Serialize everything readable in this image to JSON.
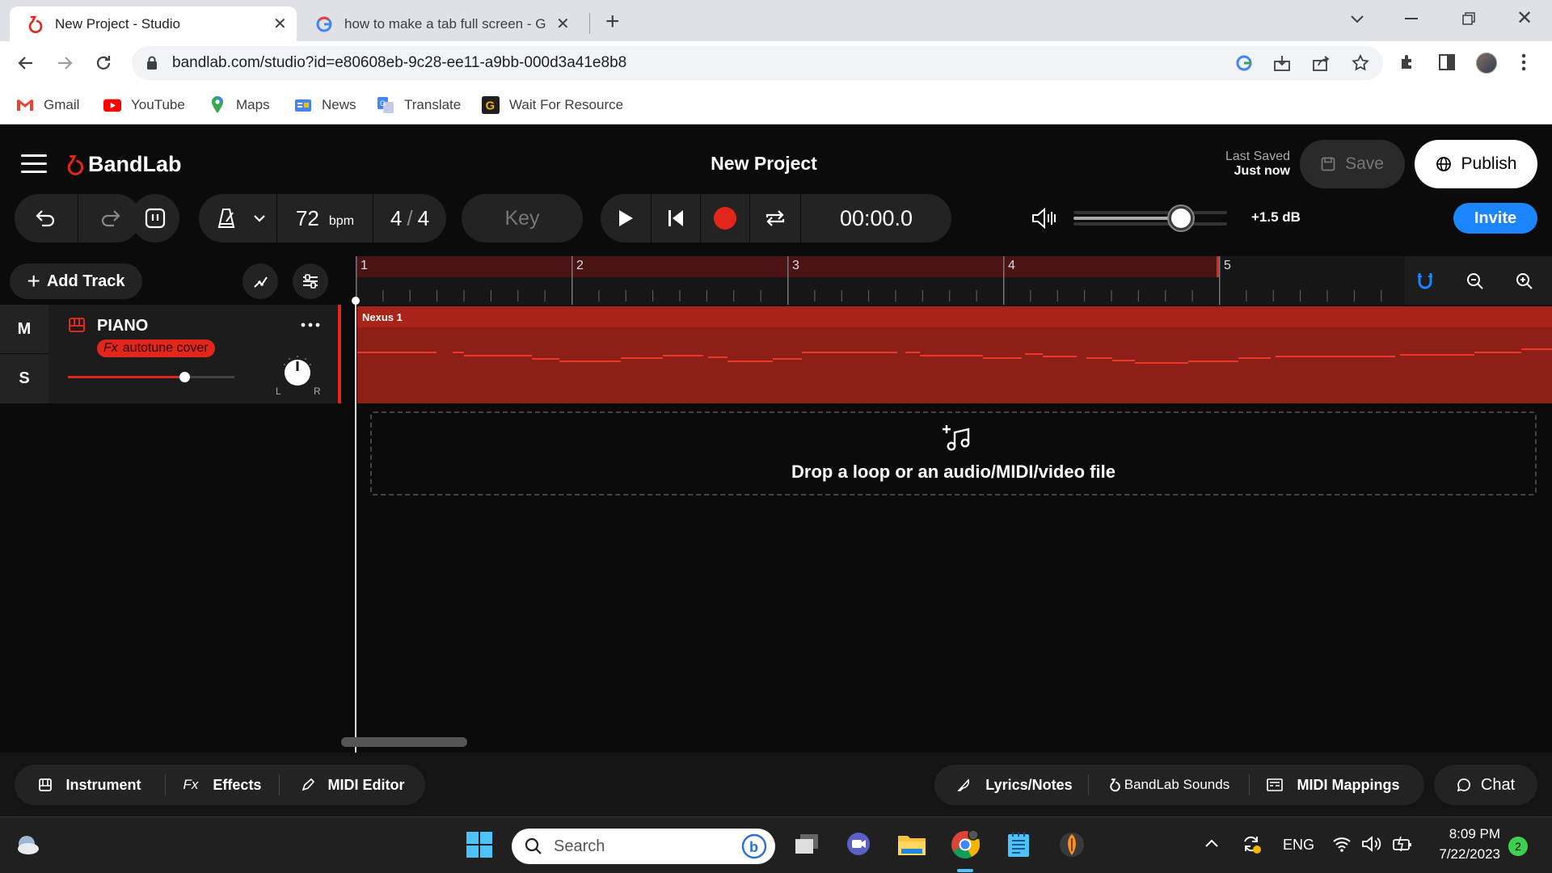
{
  "browser": {
    "tabs": [
      {
        "title": "New Project - Studio",
        "active": true
      },
      {
        "title": "how to make a tab full screen - G",
        "active": false
      }
    ],
    "url": "bandlab.com/studio?id=e80608eb-9c28-ee11-a9bb-000d3a41e8b8",
    "bookmarks": [
      "Gmail",
      "YouTube",
      "Maps",
      "News",
      "Translate",
      "Wait For Resource"
    ]
  },
  "studio": {
    "brand": "BandLab",
    "project_title": "New Project",
    "last_saved_label": "Last Saved",
    "last_saved_value": "Just now",
    "save_label": "Save",
    "publish_label": "Publish",
    "invite_label": "Invite",
    "tempo": "72",
    "tempo_unit": "bpm",
    "time_sig_num": "4",
    "time_sig_sep": "/",
    "time_sig_den": "4",
    "key_label": "Key",
    "time_display": "00:00.0",
    "master_volume_db": "+1.5 dB",
    "master_volume_level": 0.7,
    "add_track_label": "Add Track",
    "ruler_bars": [
      "1",
      "2",
      "3",
      "4",
      "5"
    ],
    "track": {
      "mute": "M",
      "solo": "S",
      "name": "PIANO",
      "effect_prefix": "Fx",
      "effect_name": "autotune cover",
      "volume_level": 0.7,
      "pan_left": "L",
      "pan_right": "R",
      "region_name": "Nexus 1",
      "color": "#e2261b"
    },
    "drop_zone_text": "Drop a loop or an audio/MIDI/video file",
    "bottom_left": [
      {
        "icon": "instrument-icon",
        "label": "Instrument",
        "prefix": ""
      },
      {
        "icon": "fx-icon",
        "label": "Effects",
        "prefix": "Fx"
      },
      {
        "icon": "pencil-icon",
        "label": "MIDI Editor",
        "prefix": ""
      }
    ],
    "bottom_right": [
      {
        "icon": "feather-icon",
        "label": "Lyrics/Notes"
      },
      {
        "icon": "bandlab-logo-icon",
        "label": "BandLab Sounds"
      },
      {
        "icon": "midi-keyboard-icon",
        "label": "MIDI Mappings"
      }
    ],
    "chat_label": "Chat",
    "accent": "#e2261b",
    "invite_color": "#1a85ff"
  },
  "taskbar": {
    "search_placeholder": "Search",
    "language": "ENG",
    "time": "8:09 PM",
    "date": "7/22/2023",
    "notification_count": "2"
  }
}
